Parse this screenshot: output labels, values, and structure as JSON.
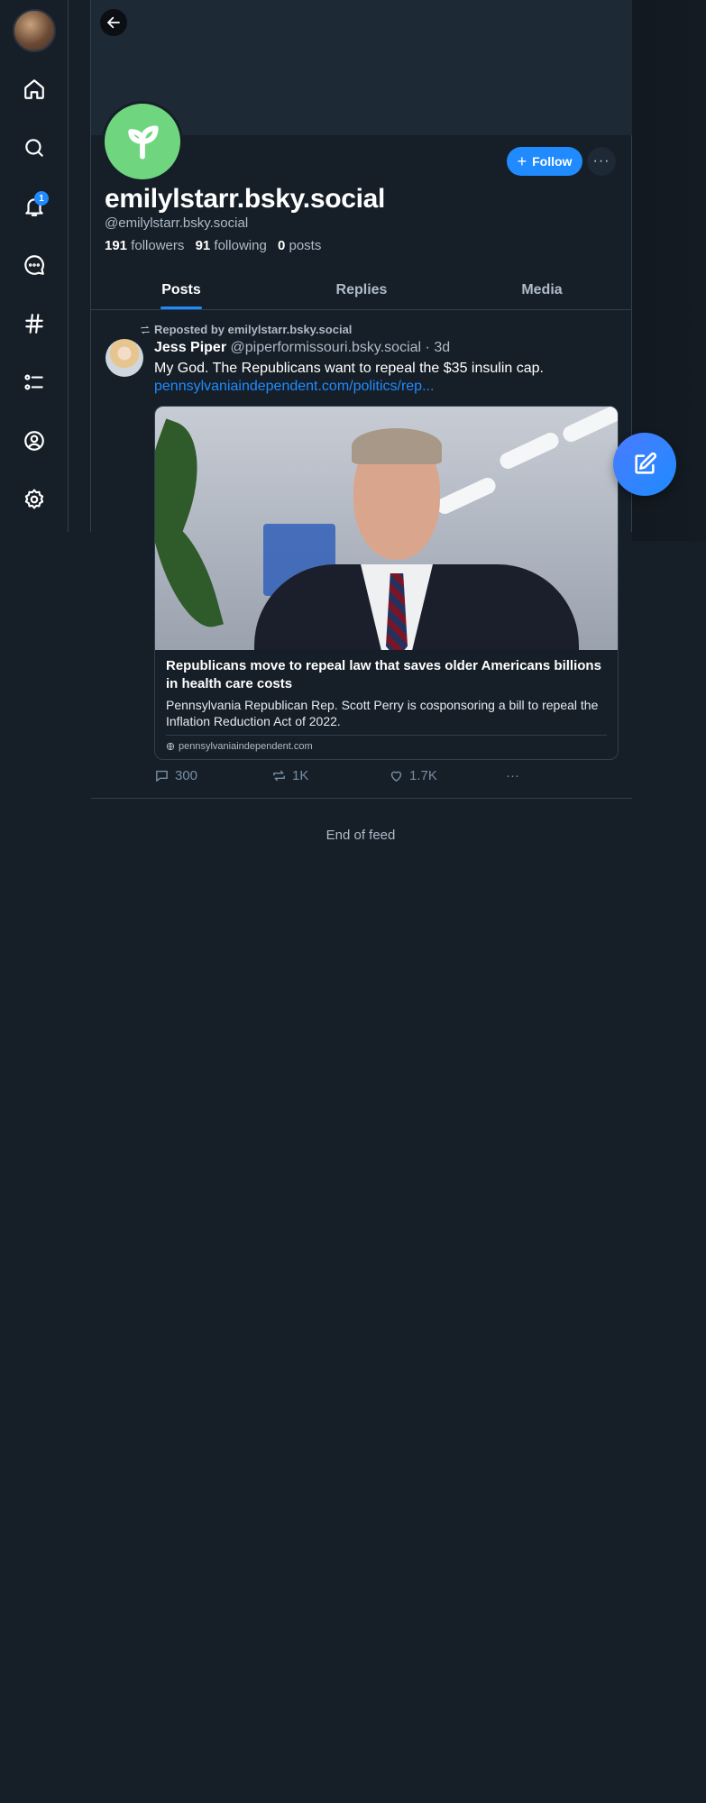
{
  "nav": {
    "notifications_badge": "1",
    "items": [
      "home-icon",
      "search-icon",
      "bell-icon",
      "chat-icon",
      "hashtag-icon",
      "list-icon",
      "profile-icon",
      "gear-icon"
    ]
  },
  "profile": {
    "display_name": "emilylstarr.bsky.social",
    "handle": "@emilylstarr.bsky.social",
    "followers_count": "191",
    "followers_label": "followers",
    "following_count": "91",
    "following_label": "following",
    "posts_count": "0",
    "posts_label": "posts",
    "follow_label": "Follow",
    "more_label": "···",
    "avatar_color": "#6fd67f"
  },
  "tabs": [
    {
      "label": "Posts",
      "active": true
    },
    {
      "label": "Replies",
      "active": false
    },
    {
      "label": "Media",
      "active": false
    }
  ],
  "post": {
    "repost_text": "Reposted by emilylstarr.bsky.social",
    "author_name": "Jess Piper",
    "author_handle": "@piperformissouri.bsky.social",
    "time_sep": "·",
    "time": "3d",
    "text": "My God. The Republicans want to repeal the $35 insulin cap.",
    "link": "pennsylvaniaindependent.com/politics/rep...",
    "embed": {
      "title": "Republicans move to repeal law that saves older Americans billions in health care costs",
      "description": "Pennsylvania Republican Rep. Scott Perry is cosponsoring a bill to repeal the Inflation Reduction Act of 2022.",
      "domain": "pennsylvaniaindependent.com"
    },
    "replies": "300",
    "reposts": "1K",
    "likes": "1.7K",
    "more": "···"
  },
  "feed_end": "End of feed",
  "colors": {
    "accent": "#208bfe",
    "background": "#161e27",
    "border": "#2e4052"
  }
}
